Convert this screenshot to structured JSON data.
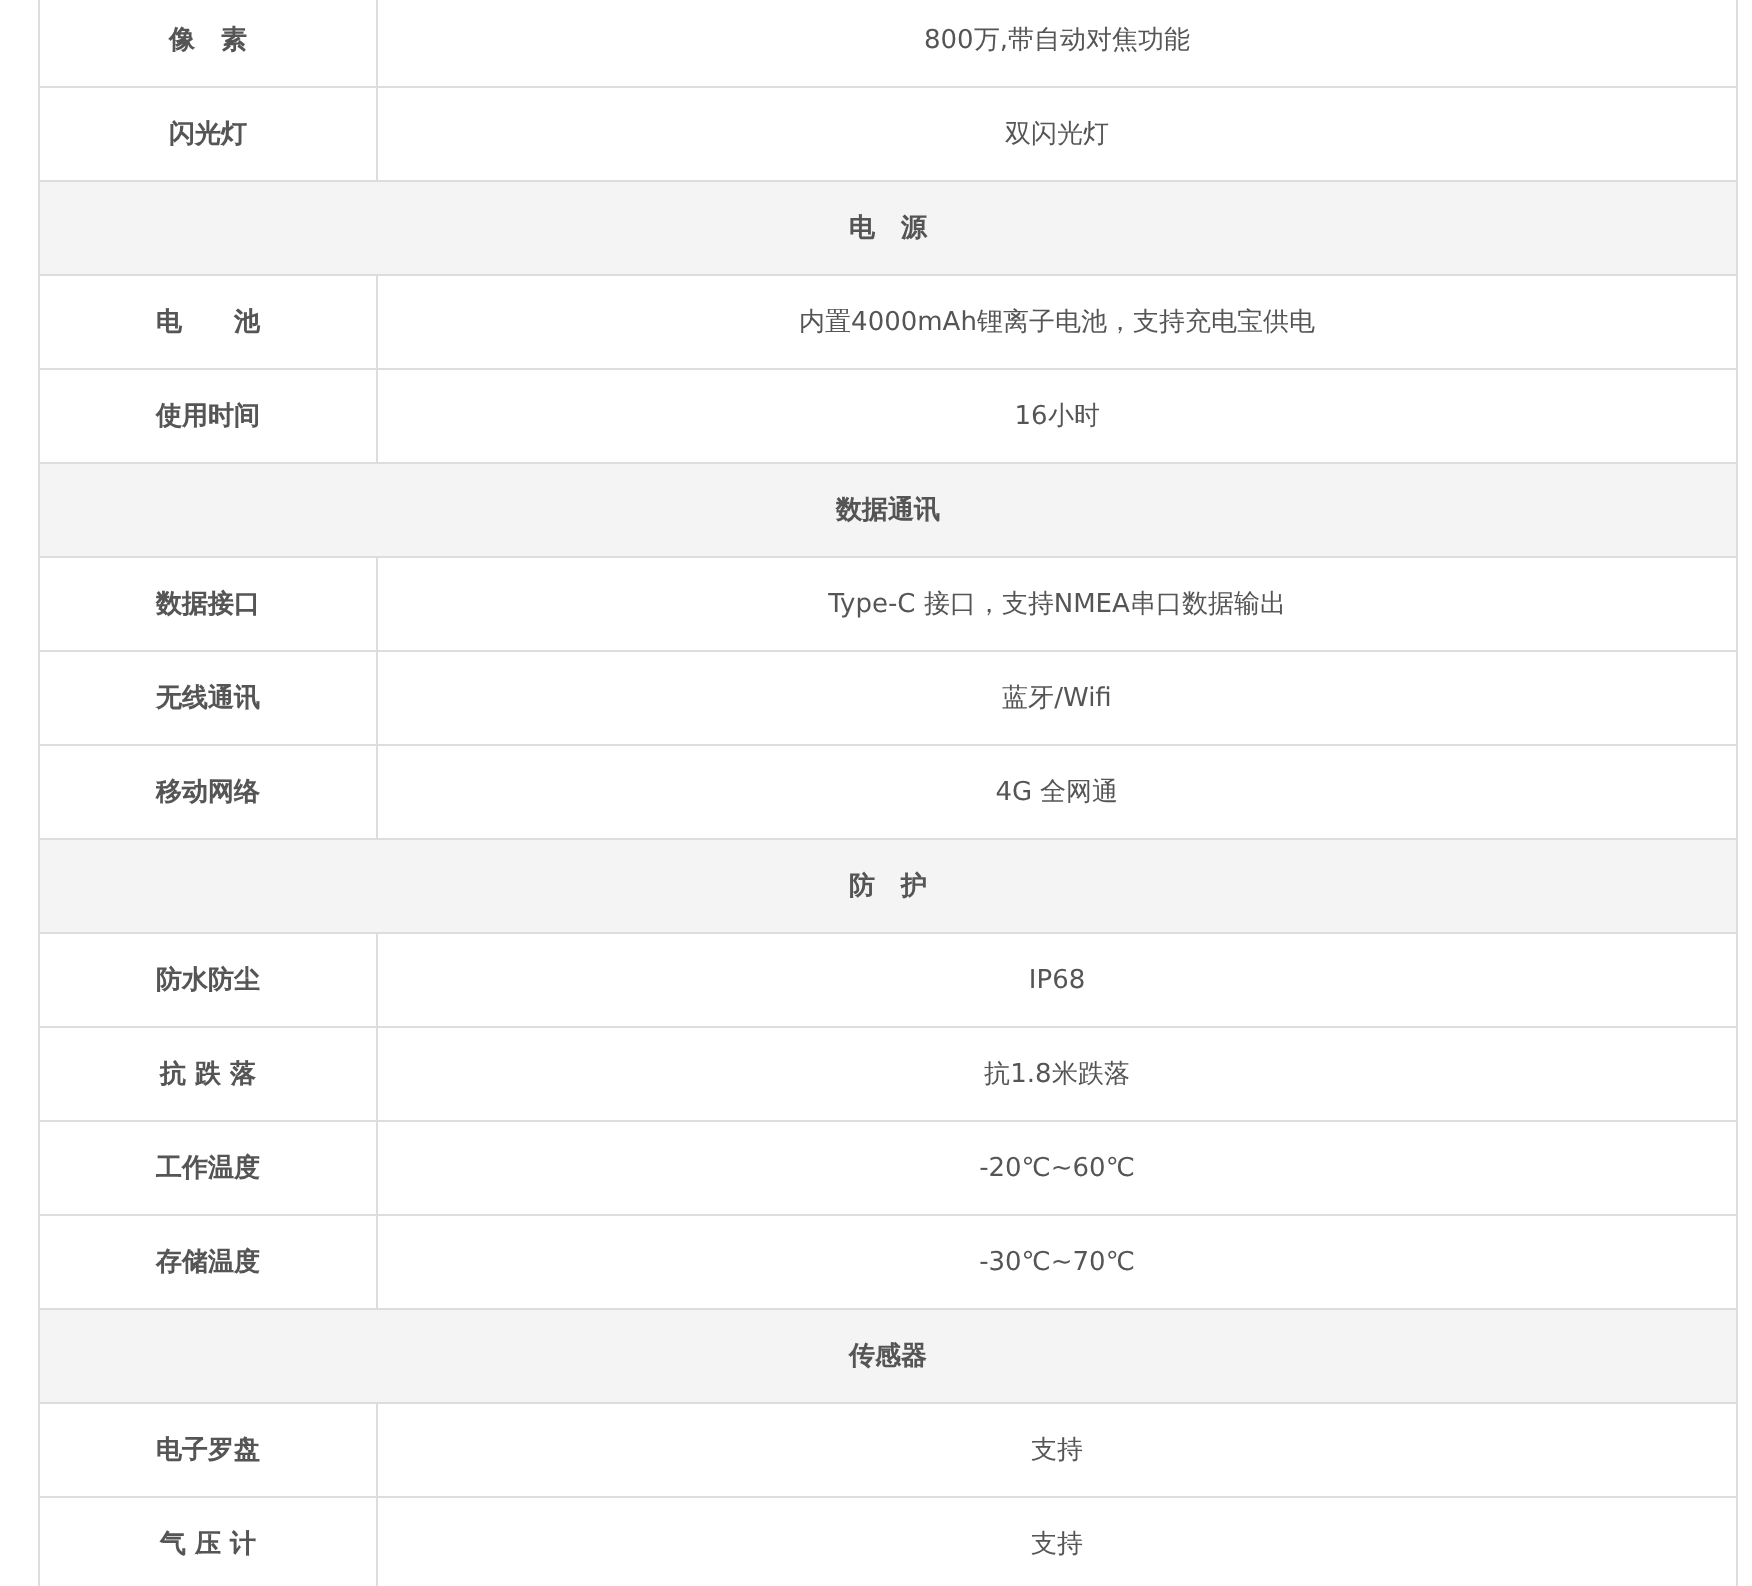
{
  "rows": [
    {
      "kind": "spec",
      "label": "像　素",
      "value": "800万,带自动对焦功能"
    },
    {
      "kind": "spec",
      "label": "闪光灯",
      "value": "双闪光灯"
    },
    {
      "kind": "section",
      "label": "电　源"
    },
    {
      "kind": "spec",
      "label": "电　　池",
      "value": "内置4000mAh锂离子电池，支持充电宝供电"
    },
    {
      "kind": "spec",
      "label": "使用时间",
      "value": "16小时"
    },
    {
      "kind": "section",
      "label": "数据通讯"
    },
    {
      "kind": "spec",
      "label": "数据接口",
      "value": "Type-C 接口，支持NMEA串口数据输出"
    },
    {
      "kind": "spec",
      "label": "无线通讯",
      "value": "蓝牙/Wifi"
    },
    {
      "kind": "spec",
      "label": "移动网络",
      "value": "4G 全网通"
    },
    {
      "kind": "section",
      "label": "防　护"
    },
    {
      "kind": "spec",
      "label": "防水防尘",
      "value": "IP68"
    },
    {
      "kind": "spec",
      "label": "抗 跌 落",
      "value": "抗1.8米跌落"
    },
    {
      "kind": "spec",
      "label": "工作温度",
      "value": "-20℃~60℃"
    },
    {
      "kind": "spec",
      "label": "存储温度",
      "value": "-30℃~70℃"
    },
    {
      "kind": "section",
      "label": "传感器"
    },
    {
      "kind": "spec",
      "label": "电子罗盘",
      "value": "支持"
    },
    {
      "kind": "spec",
      "label": "气 压 计",
      "value": "支持"
    }
  ]
}
